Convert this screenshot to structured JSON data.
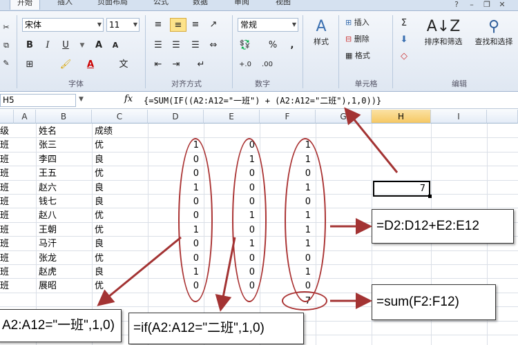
{
  "tabs": [
    {
      "label": "开始",
      "active": true
    },
    {
      "label": "插入"
    },
    {
      "label": "页面布局"
    },
    {
      "label": "公式"
    },
    {
      "label": "数据"
    },
    {
      "label": "审阅"
    },
    {
      "label": "视图"
    }
  ],
  "ribbon": {
    "font_name": "宋体",
    "font_size": "11",
    "number_format": "常规",
    "bold": "B",
    "italic": "I",
    "underline": "U",
    "grow_font": "A",
    "shrink_font": "A",
    "percent": "%",
    "comma": ",",
    "style_label": "样式",
    "insert_label": "插入",
    "delete_label": "删除",
    "format_label": "格式",
    "sort_filter_label": "排序和筛选",
    "find_select_label": "查找和选择",
    "groups": {
      "font": "字体",
      "alignment": "对齐方式",
      "number": "数字",
      "cells": "单元格",
      "editing": "编辑"
    }
  },
  "formula_bar": {
    "name_box": "H5",
    "fx": "fx",
    "formula": "{=SUM(IF((A2:A12=\"一班\") + (A2:A12=\"二班\"),1,0))}"
  },
  "sheet": {
    "columns": [
      "A",
      "B",
      "C",
      "D",
      "E",
      "F",
      "G",
      "H",
      "I"
    ],
    "selected_column": "H",
    "header_row": {
      "a": "级",
      "b": "姓名",
      "c": "成绩"
    },
    "rows": [
      {
        "a": "班",
        "b": "张三",
        "c": "优",
        "d": "1",
        "e": "0",
        "f": "1"
      },
      {
        "a": "班",
        "b": "李四",
        "c": "良",
        "d": "0",
        "e": "1",
        "f": "1"
      },
      {
        "a": "班",
        "b": "王五",
        "c": "优",
        "d": "0",
        "e": "0",
        "f": "0"
      },
      {
        "a": "班",
        "b": "赵六",
        "c": "良",
        "d": "1",
        "e": "0",
        "f": "1"
      },
      {
        "a": "班",
        "b": "钱七",
        "c": "良",
        "d": "0",
        "e": "0",
        "f": "0"
      },
      {
        "a": "班",
        "b": "赵八",
        "c": "优",
        "d": "0",
        "e": "1",
        "f": "1"
      },
      {
        "a": "班",
        "b": "王朝",
        "c": "优",
        "d": "1",
        "e": "0",
        "f": "1"
      },
      {
        "a": "班",
        "b": "马汗",
        "c": "良",
        "d": "0",
        "e": "1",
        "f": "1"
      },
      {
        "a": "班",
        "b": "张龙",
        "c": "优",
        "d": "0",
        "e": "0",
        "f": "0"
      },
      {
        "a": "班",
        "b": "赵虎",
        "c": "良",
        "d": "1",
        "e": "0",
        "f": "1"
      },
      {
        "a": "班",
        "b": "展昭",
        "c": "优",
        "d": "0",
        "e": "0",
        "f": "0"
      }
    ],
    "f_total": "7",
    "h5_value": "7"
  },
  "callouts": {
    "sum_de": "=D2:D12+E2:E12",
    "sum_f": "=sum(F2:F12)",
    "if_banner_1": "A2:A12=\"一班\",1,0)",
    "if_banner_2": "=if(A2:A12=\"二班\",1,0)"
  },
  "colors": {
    "annotation": "#a33333",
    "selection_header": "#f6c863"
  }
}
